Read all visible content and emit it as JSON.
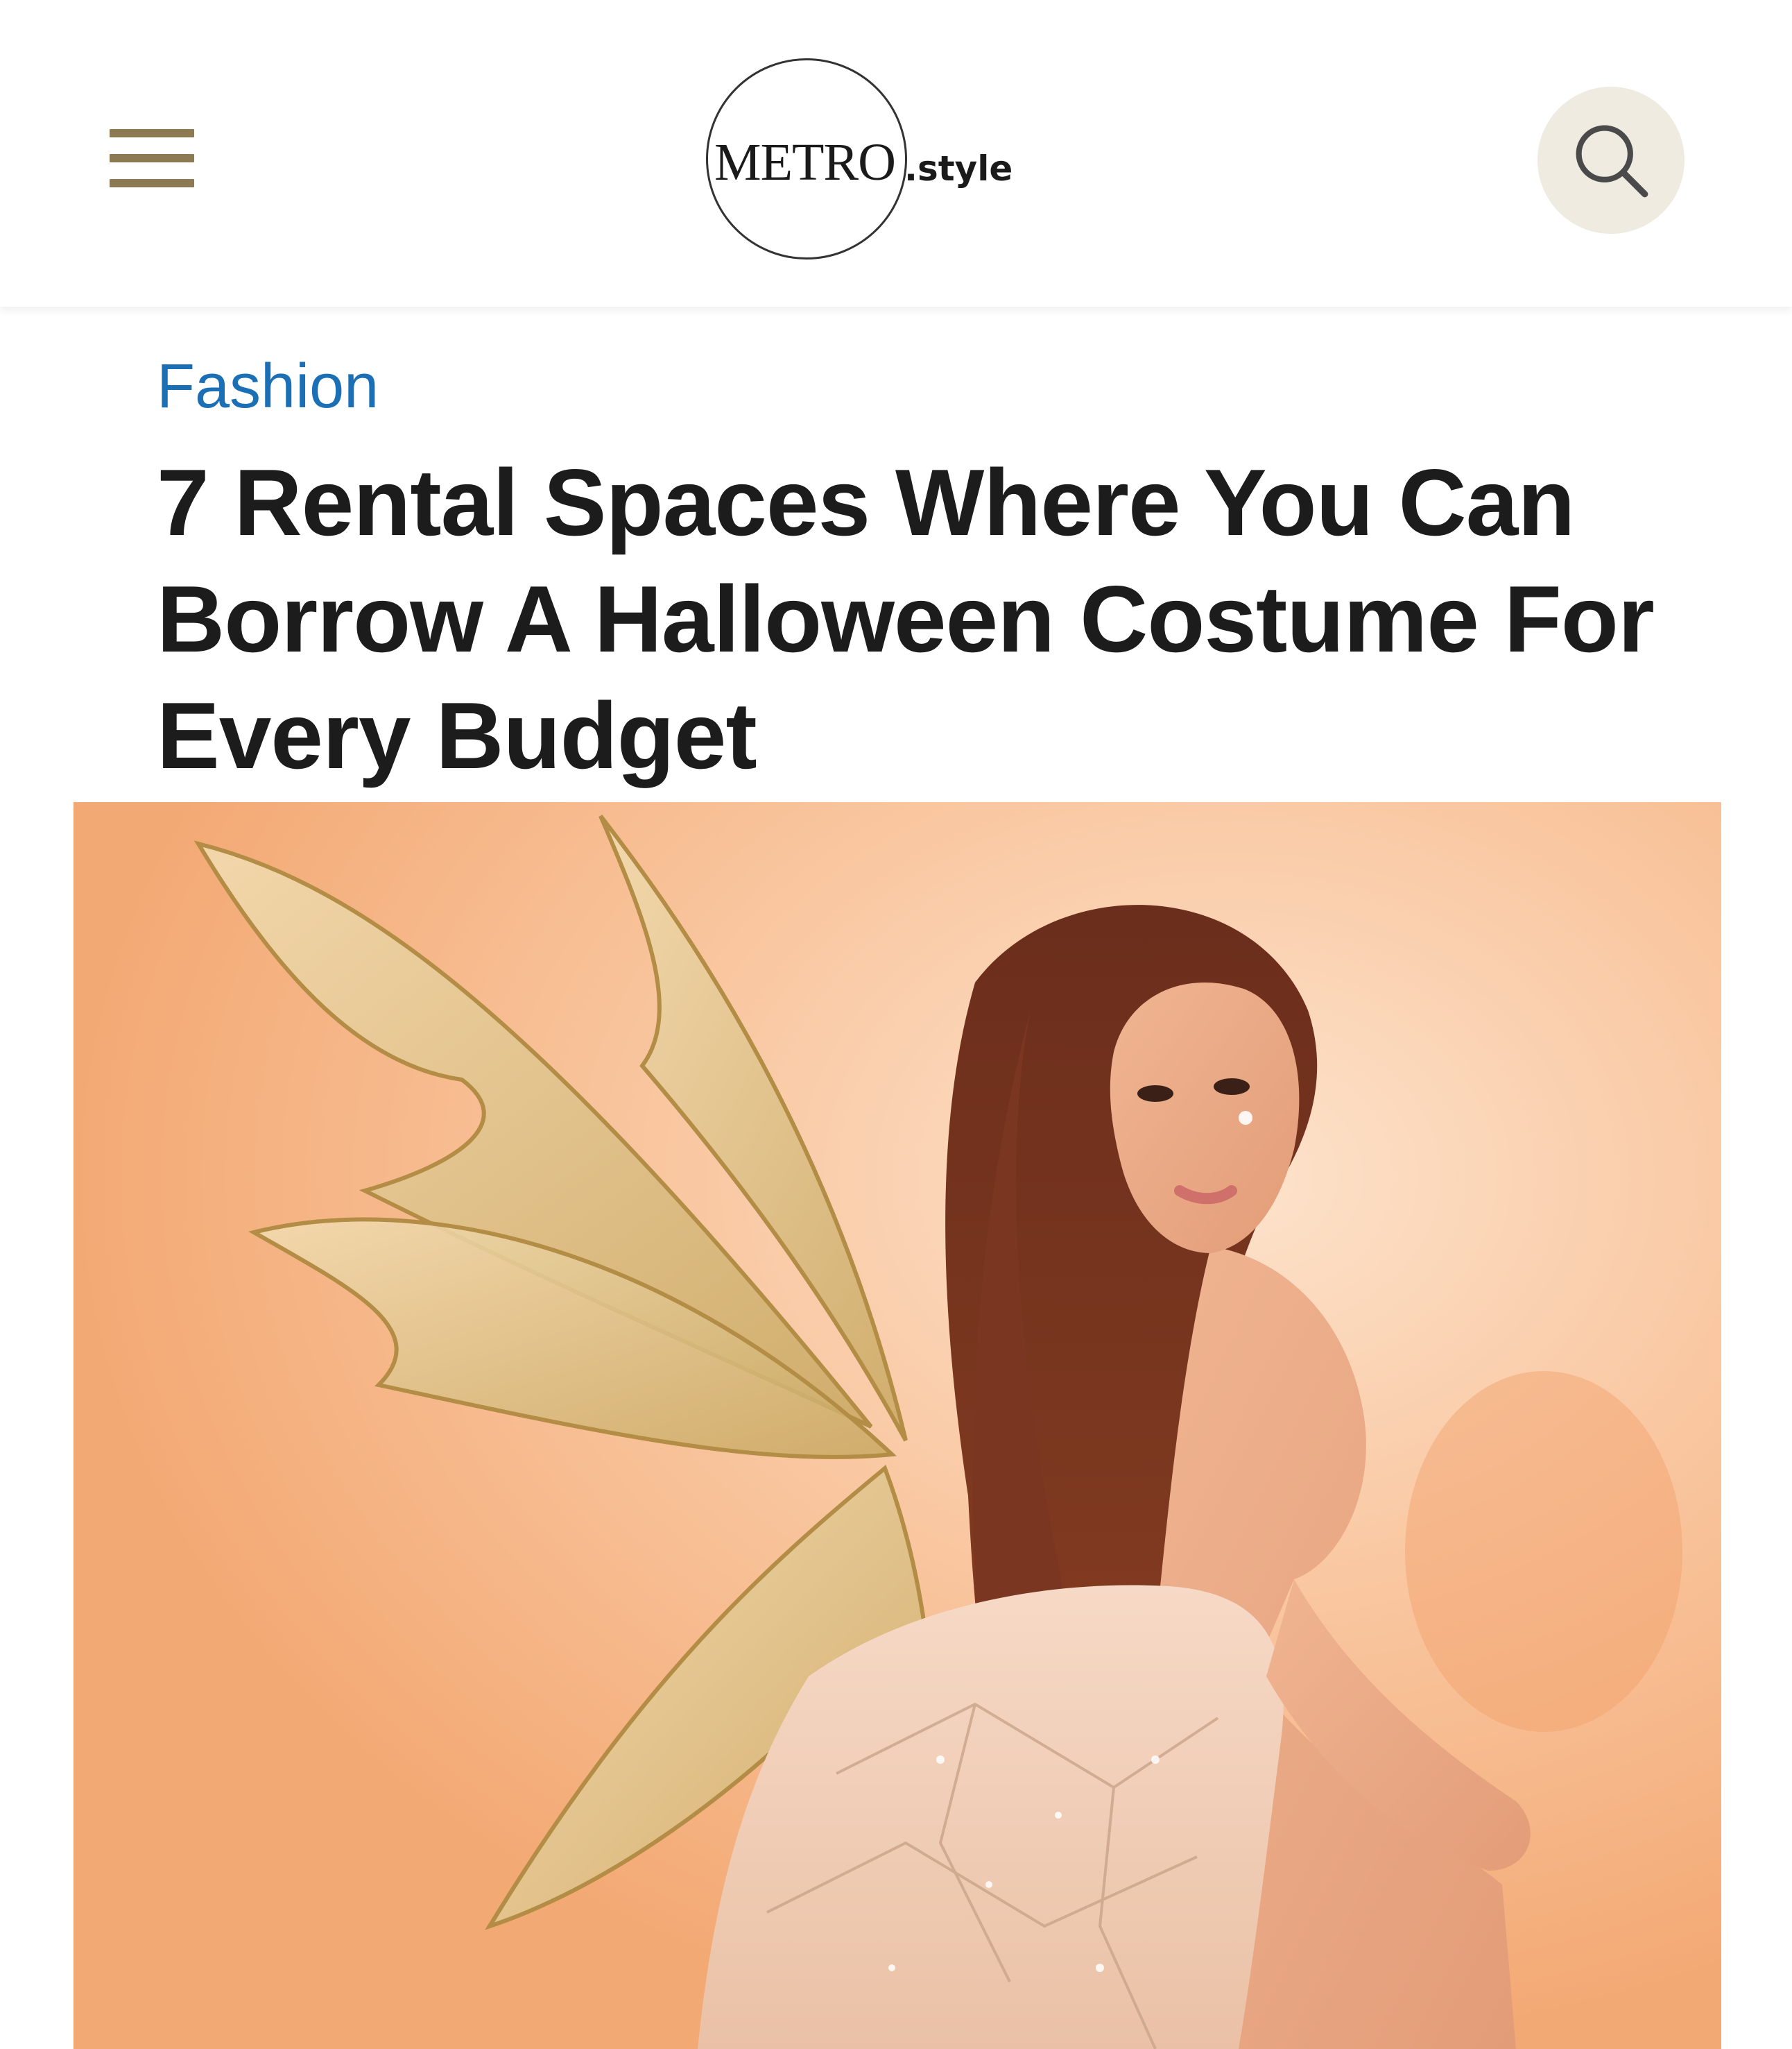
{
  "header": {
    "menu_icon": "hamburger-menu-icon",
    "logo": {
      "brand": "METRO",
      "suffix": ".style"
    },
    "search_icon": "search-icon",
    "colors": {
      "menu": "#8b7a52",
      "search_bg": "#efebe0"
    }
  },
  "article": {
    "category": "Fashion",
    "title": "7 Rental Spaces Where You Can Borrow A Halloween Costume For Every Budget",
    "category_color": "#1b6fb5"
  },
  "hero_image": {
    "subject": "photo"
  }
}
